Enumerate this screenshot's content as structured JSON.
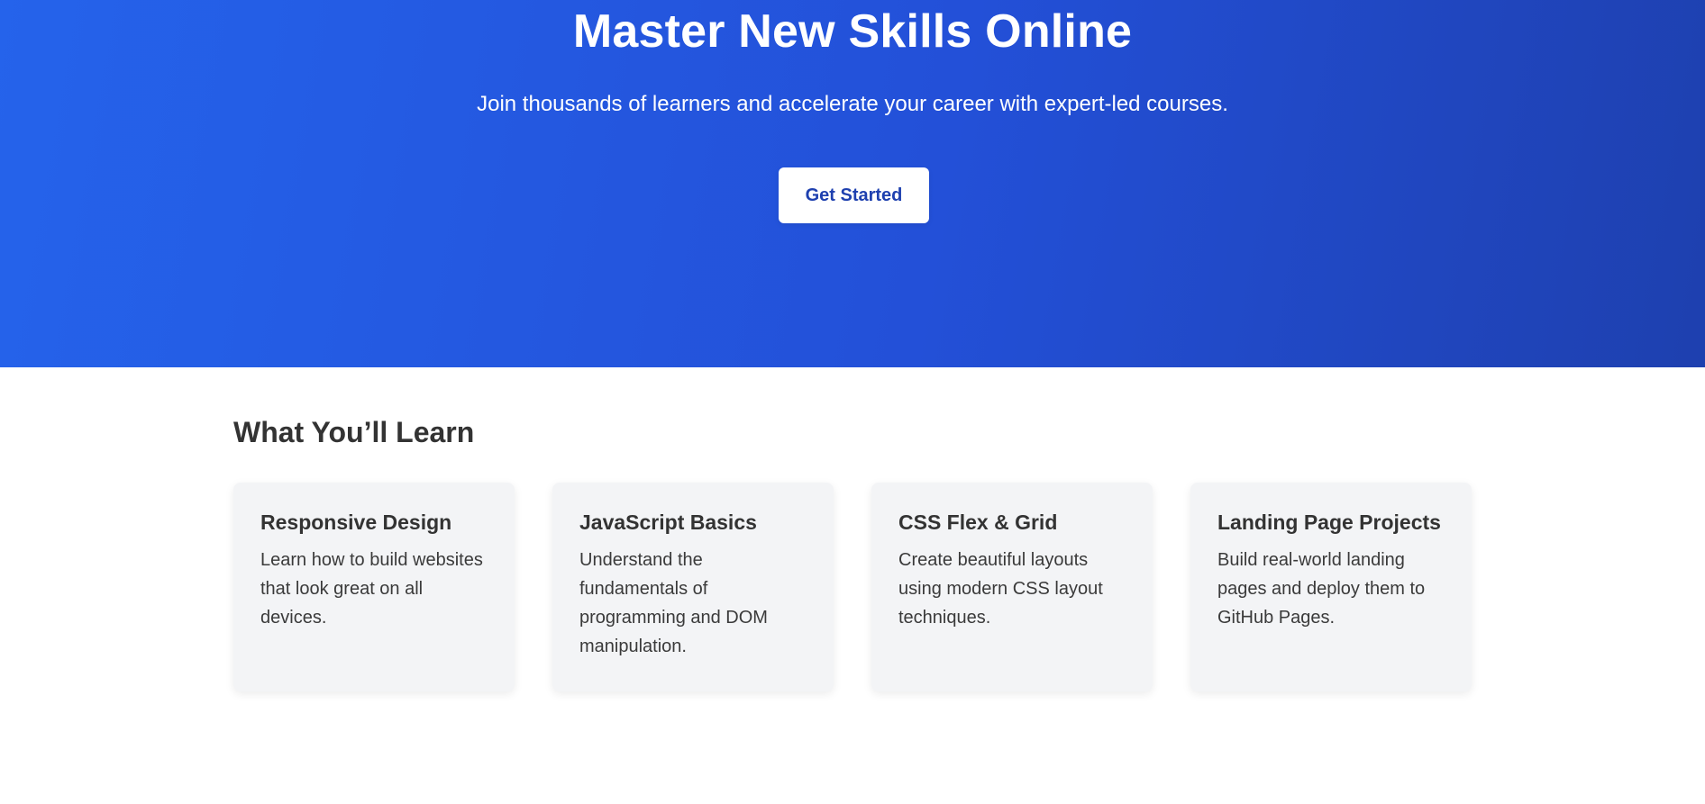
{
  "hero": {
    "title": "Master New Skills Online",
    "subtitle": "Join thousands of learners and accelerate your career with expert-led courses.",
    "cta_label": "Get Started",
    "gradient_start": "#2563eb",
    "gradient_end": "#1e40af"
  },
  "learn": {
    "title": "What You’ll Learn",
    "cards": [
      {
        "title": "Responsive Design",
        "description": "Learn how to build websites that look great on all devices."
      },
      {
        "title": "JavaScript Basics",
        "description": "Understand the fundamentals of programming and DOM manipulation."
      },
      {
        "title": "CSS Flex & Grid",
        "description": "Create beautiful layouts using modern CSS layout techniques."
      },
      {
        "title": "Landing Page Projects",
        "description": "Build real-world landing pages and deploy them to GitHub Pages."
      }
    ]
  },
  "colors": {
    "card_background": "#f3f4f6",
    "text": "#333333",
    "button_text": "#1e40af"
  }
}
